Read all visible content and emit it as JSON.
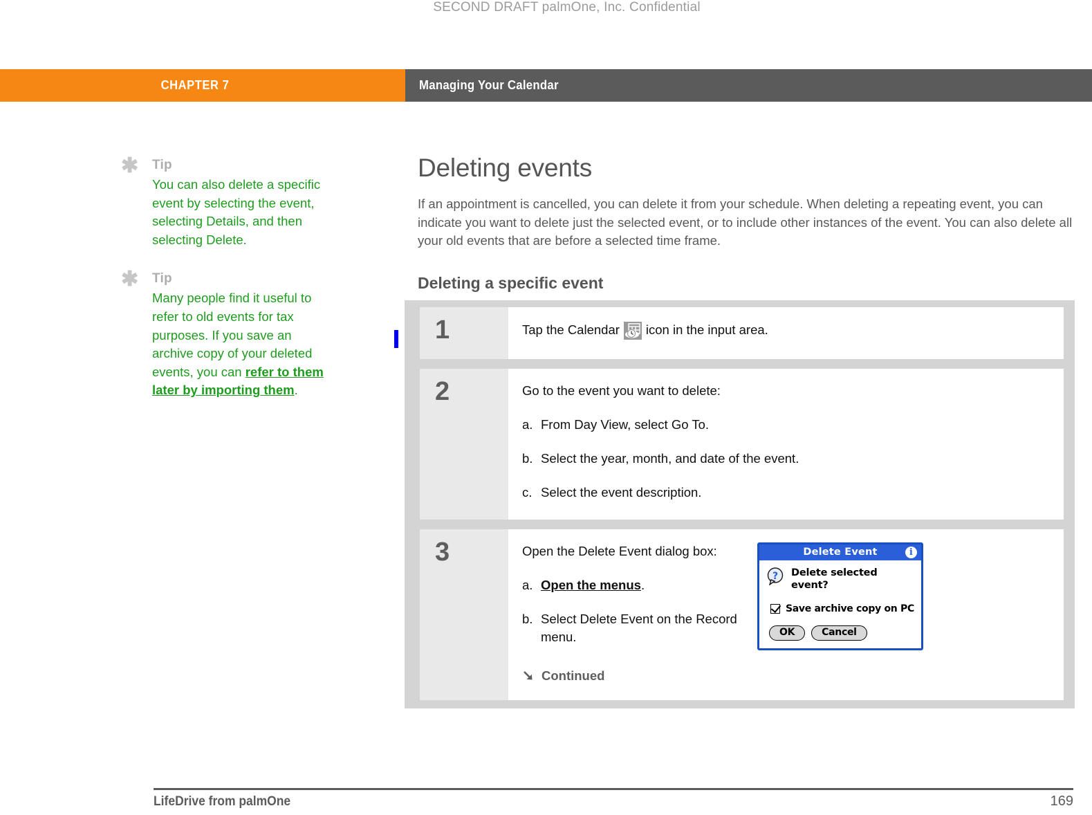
{
  "draft_notice": "SECOND DRAFT palmOne, Inc.  Confidential",
  "header": {
    "chapter": "CHAPTER 7",
    "title": "Managing Your Calendar"
  },
  "sidebar": {
    "tips": [
      {
        "label": "Tip",
        "icon": "asterisk-icon",
        "text": "You can also delete a specific event by selecting the event, selecting Details, and then selecting Delete.",
        "link_text": "",
        "text_after_link": ""
      },
      {
        "label": "Tip",
        "icon": "asterisk-icon",
        "text": "Many people find it useful to refer to old events for tax purposes. If you save an archive copy of your deleted events, you can ",
        "link_text": "refer to them later by importing them",
        "text_after_link": "."
      }
    ]
  },
  "main": {
    "heading": "Deleting events",
    "intro": "If an appointment is cancelled, you can delete it from your schedule. When deleting a repeating event, you can indicate you want to delete just the selected event, or to include other instances of the event. You can also delete all your old events that are before a selected time frame.",
    "subheading": "Deleting a specific event"
  },
  "steps": [
    {
      "number": "1",
      "lines": [
        {
          "marker": "",
          "text_before_icon": "Tap the Calendar",
          "icon": "calendar-icon",
          "text_after_icon": "icon in the input area."
        }
      ]
    },
    {
      "number": "2",
      "lines": [
        {
          "marker": "",
          "text": "Go to the event you want to delete:"
        },
        {
          "marker": "a.",
          "text": "From Day View, select Go To."
        },
        {
          "marker": "b.",
          "text": "Select the year, month, and date of the event."
        },
        {
          "marker": "c.",
          "text": "Select the event description."
        }
      ]
    },
    {
      "number": "3",
      "lines": [
        {
          "marker": "",
          "text": "Open the Delete Event dialog box:"
        },
        {
          "marker": "a.",
          "link_text": "Open the menus",
          "text": "."
        },
        {
          "marker": "b.",
          "text": "Select Delete Event on the Record menu."
        }
      ],
      "continued_label": "Continued"
    }
  ],
  "dialog": {
    "title": "Delete Event",
    "info_icon": "info-icon",
    "question_icon": "question-icon",
    "question_text": "Delete selected event?",
    "checkbox": {
      "checked": true,
      "label": "Save archive copy on PC"
    },
    "buttons": [
      {
        "label": "OK"
      },
      {
        "label": "Cancel"
      }
    ]
  },
  "footer": {
    "left": "LifeDrive from palmOne",
    "page_number": "169"
  },
  "colors": {
    "chapter_orange": "#f68712",
    "header_gray": "#5b5b5b",
    "tip_green": "#1f9c1f",
    "step_panel_gray": "#d4d4d4",
    "step_number_gray": "#e9e9e9",
    "dialog_blue": "#2b5fd9",
    "change_bar_blue": "#0000f0"
  }
}
